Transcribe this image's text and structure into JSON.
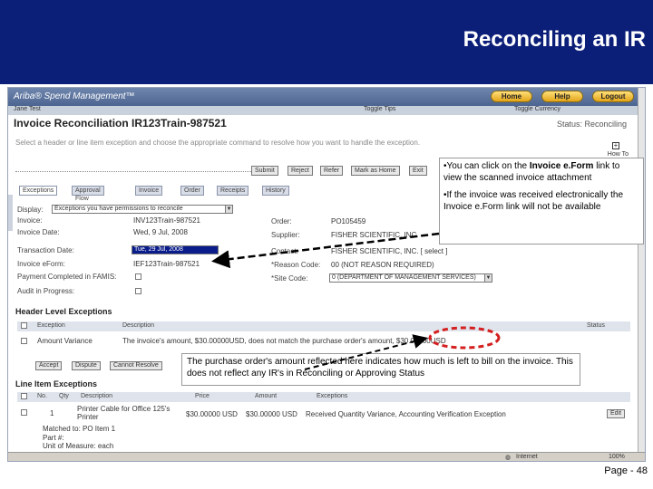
{
  "slide": {
    "title": "Reconciling an IR",
    "page": "Page - 48"
  },
  "app": {
    "logo": "Ariba® Spend Management™",
    "buttons": [
      "Home",
      "Help",
      "Logout"
    ],
    "menu": {
      "user": "Jane Test",
      "toggle_tips": "Toggle Tips",
      "toggle_currency": "Toggle Currency"
    },
    "page_title": "Invoice Reconciliation IR123Train-987521",
    "status": "Status: Reconciling",
    "instruction": "Select a header or line item exception and choose the appropriate command to resolve how you want to handle the exception.",
    "how_to": "How To",
    "actions": [
      "Submit",
      "Reject",
      "Refer",
      "Mark as Home",
      "Exit"
    ],
    "tabs": [
      "Exceptions",
      "Approval Flow",
      "Invoice",
      "Order",
      "Receipts",
      "History"
    ],
    "fields": {
      "display_label": "Display:",
      "display_value": "Exceptions you have permissions to reconcile",
      "invoice_label": "Invoice:",
      "invoice_value": "INV123Train-987521",
      "invoice_date_label": "Invoice Date:",
      "invoice_date_value": "Wed, 9 Jul, 2008",
      "transaction_date_label": "Transaction Date:",
      "transaction_date_value": "Tue, 29 Jul, 2008",
      "invoice_eform_label": "Invoice eForm:",
      "invoice_eform_value": "IEF123Train-987521",
      "payment_completed_label": "Payment Completed in FAMIS:",
      "audit_label": "Audit in Progress:",
      "order_label": "Order:",
      "order_value": "PO105459",
      "supplier_label": "Supplier:",
      "supplier_value": "FISHER SCIENTIFIC, INC.",
      "contact_label": "Contact:",
      "contact_value": "FISHER SCIENTIFIC, INC. [ select ]",
      "reason_label": "*Reason Code:",
      "reason_value": "00 (NOT REASON REQUIRED)",
      "site_label": "*Site Code:",
      "site_value": "0 (DEPARTMENT OF MANAGEMENT SERVICES)"
    },
    "header_exceptions": {
      "title": "Header Level Exceptions",
      "columns": [
        "Exception",
        "Description",
        "Status"
      ],
      "row": {
        "exception": "Amount Variance",
        "description": "The invoice's amount, $30.00000USD, does not match the purchase order's amount, $30.00000USD"
      },
      "buttons": [
        "Accept",
        "Dispute",
        "Cannot Resolve"
      ]
    },
    "line_exceptions": {
      "title": "Line Item Exceptions",
      "columns": [
        "No.",
        "Qty",
        "Description",
        "Price",
        "Amount",
        "Exceptions"
      ],
      "row": {
        "qty": "1",
        "description": "Printer Cable for Office 125's Printer",
        "price": "$30.00000 USD",
        "amount": "$30.00000 USD",
        "exceptions": "Received Quantity Variance, Accounting Verification Exception",
        "edit": "Edit",
        "detail1": "Matched to: PO Item 1",
        "detail2": "Part #:",
        "detail3": "Unit of Measure: each"
      }
    },
    "statusbar": {
      "zone": "Internet",
      "zoom": "100%"
    }
  },
  "callouts": {
    "top_1_pre": "•You can click on the ",
    "top_1_bold": "Invoice e.Form",
    "top_1_post": " link to view the scanned invoice attachment",
    "top_2": "•If the invoice was received electronically the Invoice e.Form link will not be available",
    "bottom": "The purchase order's amount reflected here indicates how much is left to bill on the invoice.  This does not reflect any IR's in Reconciling or Approving Status"
  },
  "colors": {
    "header_bg": "#0b1e78",
    "arrow": "#000000",
    "highlight_ring": "#d42020"
  }
}
